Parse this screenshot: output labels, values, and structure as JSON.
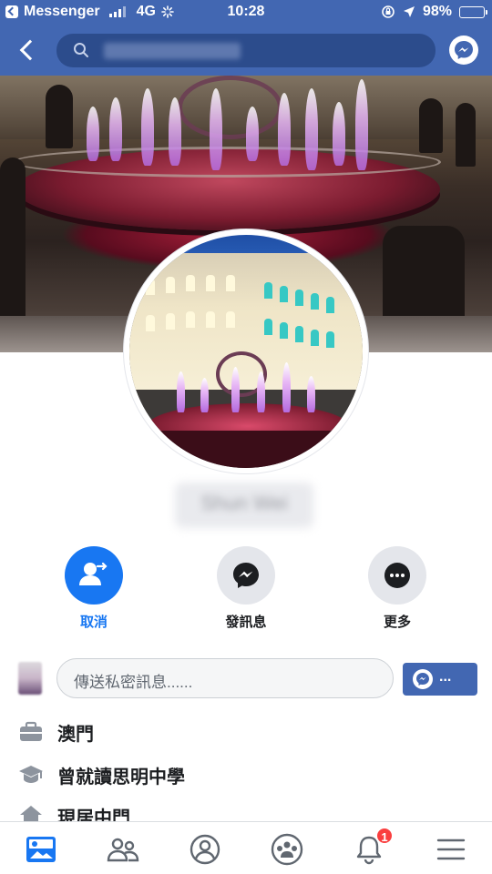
{
  "status_bar": {
    "back_app": "Messenger",
    "network": "4G",
    "time": "10:28",
    "battery": "98%"
  },
  "header": {
    "search_placeholder": ""
  },
  "profile": {
    "name": "Shun Wei"
  },
  "actions": [
    {
      "label": "取消",
      "icon": "remove-friend-icon"
    },
    {
      "label": "發訊息",
      "icon": "messenger-icon"
    },
    {
      "label": "更多",
      "icon": "more-icon"
    }
  ],
  "message": {
    "placeholder": "傳送私密訊息......",
    "send_label": "..."
  },
  "info": [
    {
      "icon": "briefcase-icon",
      "text": "澳門"
    },
    {
      "icon": "graduation-cap-icon",
      "text": "曾就讀思明中學"
    },
    {
      "icon": "home-icon",
      "text": "現居中門"
    }
  ],
  "tabs": {
    "notifications_badge": "1"
  },
  "colors": {
    "brand": "#4267b2",
    "accent": "#1877f2",
    "badge": "#fa3e3e"
  }
}
